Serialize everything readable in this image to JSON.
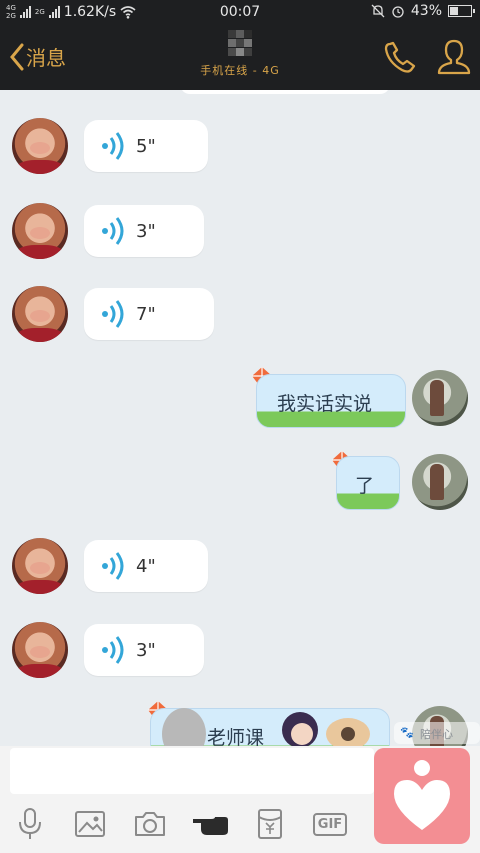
{
  "status_bar": {
    "network_top": "4G",
    "network_bottom": "2G",
    "network_alt_top": "2G",
    "speed": "1.62K/s",
    "time": "00:07",
    "battery": "43%",
    "battery_level": 0.43
  },
  "header": {
    "back_label": "消息",
    "subtitle": "手机在线 - 4G"
  },
  "messages": [
    {
      "side": "left",
      "type": "voice",
      "duration": "5\""
    },
    {
      "side": "left",
      "type": "voice",
      "duration": "3\""
    },
    {
      "side": "left",
      "type": "voice",
      "duration": "7\""
    },
    {
      "side": "right",
      "type": "text",
      "text": "我实话实说"
    },
    {
      "side": "right",
      "type": "text",
      "text": "了"
    },
    {
      "side": "left",
      "type": "voice",
      "duration": "4\""
    },
    {
      "side": "left",
      "type": "voice",
      "duration": "3\""
    },
    {
      "side": "right",
      "type": "text",
      "text": "老师课"
    }
  ],
  "toolbar": {
    "gif_label": "GIF"
  },
  "watermark": "陪伴心"
}
